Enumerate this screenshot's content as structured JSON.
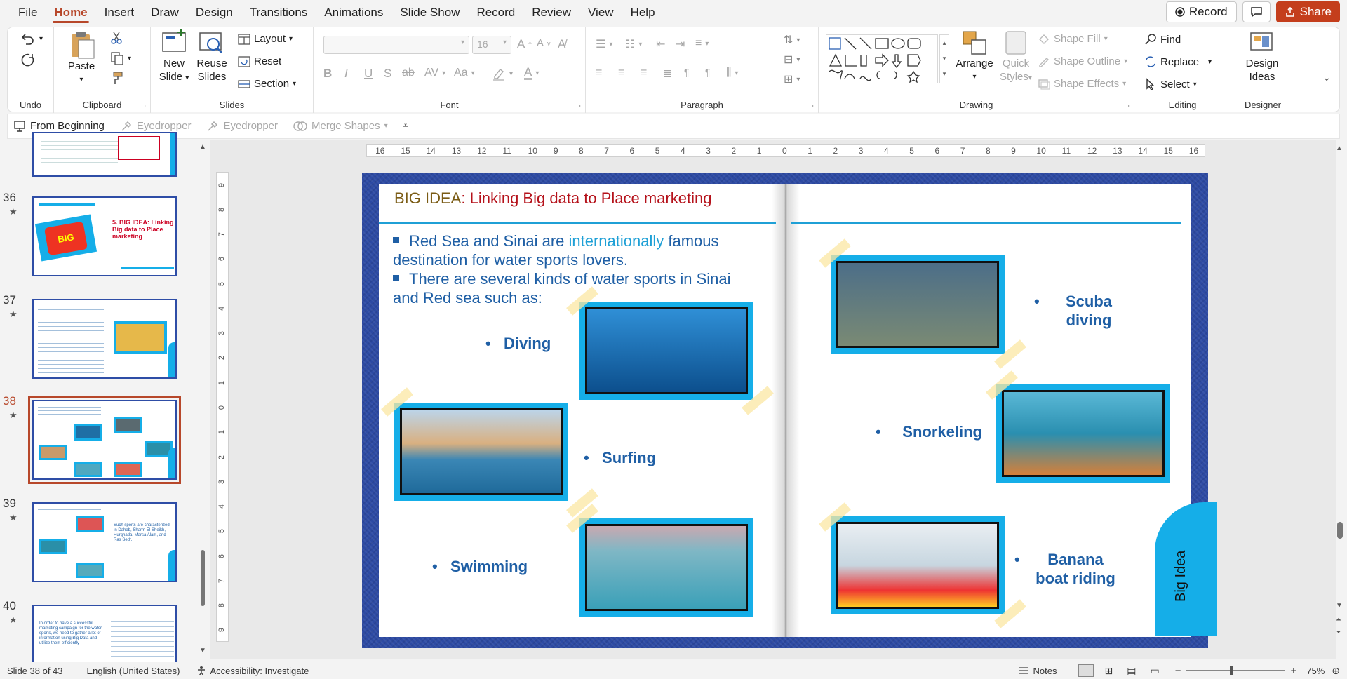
{
  "menu": {
    "tabs": [
      "File",
      "Home",
      "Insert",
      "Draw",
      "Design",
      "Transitions",
      "Animations",
      "Slide Show",
      "Record",
      "Review",
      "View",
      "Help"
    ],
    "active_tab": "Home",
    "record_label": "Record",
    "share_label": "Share"
  },
  "ribbon": {
    "undo_group": "Undo",
    "clipboard": {
      "paste": "Paste",
      "group": "Clipboard"
    },
    "slides": {
      "new_slide_1": "New",
      "new_slide_2": "Slide",
      "reuse_1": "Reuse",
      "reuse_2": "Slides",
      "layout": "Layout",
      "reset": "Reset",
      "section": "Section",
      "group": "Slides"
    },
    "font": {
      "size": "16",
      "aa": "Aa",
      "group": "Font"
    },
    "paragraph": {
      "group": "Paragraph"
    },
    "drawing": {
      "arrange": "Arrange",
      "quick_styles_1": "Quick",
      "quick_styles_2": "Styles",
      "shape_fill": "Shape Fill",
      "shape_outline": "Shape Outline",
      "shape_effects": "Shape Effects",
      "group": "Drawing"
    },
    "editing": {
      "find": "Find",
      "replace": "Replace",
      "select": "Select",
      "group": "Editing"
    },
    "designer": {
      "ideas_1": "Design",
      "ideas_2": "Ideas",
      "group": "Designer"
    }
  },
  "qat": {
    "from_beginning": "From Beginning",
    "eyedropper_1": "Eyedropper",
    "eyedropper_2": "Eyedropper",
    "merge_shapes": "Merge Shapes"
  },
  "thumbnails": [
    {
      "num": "36",
      "title": "5. BIG IDEA: Linking Big data to Place marketing"
    },
    {
      "num": "37"
    },
    {
      "num": "38",
      "selected": true
    },
    {
      "num": "39",
      "text": "Such sports are characterized in Dahab, Sharm El-Sheikh, Hurghada, Marsa Alam, and Ras Sedr."
    },
    {
      "num": "40",
      "text": "In order to have a successful marketing campaign for the water sports, we need to gather a lot of information using Big Data and utilize them efficiently"
    }
  ],
  "slide": {
    "title_prefix": "BIG IDEA",
    "title_rest": ": Linking Big data to Place marketing",
    "bullet1_a": "Red Sea and Sinai are ",
    "bullet1_hl": "internationally",
    "bullet1_b": " famous destination for water sports lovers.",
    "bullet2": "There are several kinds of water sports in Sinai and Red sea such as:",
    "sports": [
      "Diving",
      "Surfing",
      "Swimming",
      "Scuba diving",
      "Snorkeling",
      "Banana boat riding"
    ],
    "tab_label": "Big Idea"
  },
  "ruler": {
    "h_ticks": [
      "16",
      "15",
      "14",
      "13",
      "12",
      "11",
      "10",
      "9",
      "8",
      "7",
      "6",
      "5",
      "4",
      "3",
      "2",
      "1",
      "0",
      "1",
      "2",
      "3",
      "4",
      "5",
      "6",
      "7",
      "8",
      "9",
      "10",
      "11",
      "12",
      "13",
      "14",
      "15",
      "16"
    ],
    "v_ticks": [
      "9",
      "8",
      "7",
      "6",
      "5",
      "4",
      "3",
      "2",
      "1",
      "0",
      "1",
      "2",
      "3",
      "4",
      "5",
      "6",
      "7",
      "8",
      "9"
    ]
  },
  "status": {
    "slide_of": "Slide 38 of 43",
    "language": "English (United States)",
    "accessibility": "Accessibility: Investigate",
    "notes": "Notes",
    "zoom": "75%"
  }
}
